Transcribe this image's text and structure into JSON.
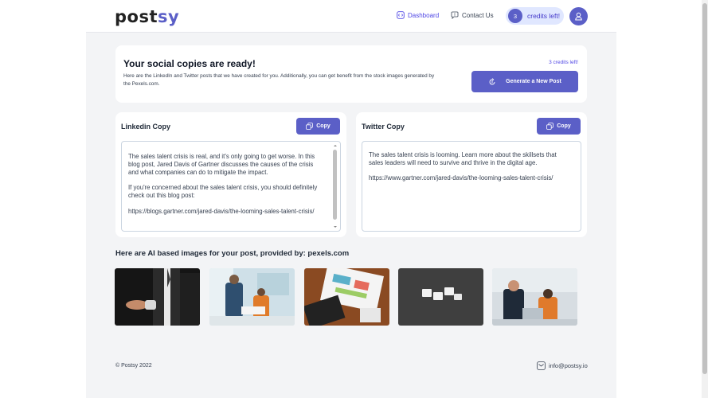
{
  "brand": {
    "logo_main": "post",
    "logo_accent": "sy",
    "accent_color": "#5b5fc7"
  },
  "nav": {
    "dashboard_label": "Dashboard",
    "dashboard_icon": "dashboard-icon",
    "contact_label": "Contact Us",
    "contact_icon": "chat-icon",
    "credits_count": "3",
    "credits_label": "credits left!",
    "avatar_icon": "user-icon"
  },
  "hero": {
    "title": "Your social copies are ready!",
    "description": "Here are the LinkedIn and Twitter posts that we have created for you. Additionally, you can get benefit from the stock images generated by the Pexels.com.",
    "credits_text": "3 credits left!",
    "generate_label": "Generate a New Post",
    "generate_icon": "refresh-icon"
  },
  "linkedin": {
    "title": "Linkedin Copy",
    "copy_label": "Copy",
    "copy_icon": "copy-icon",
    "text": "The sales talent crisis is real, and it's only going to get worse. In this blog post, Jared Davis of Gartner discusses the causes of the crisis and what companies can do to mitigate the impact.\n\nIf you're concerned about the sales talent crisis, you should definitely check out this blog post:\n\nhttps://blogs.gartner.com/jared-davis/the-looming-sales-talent-crisis/"
  },
  "twitter": {
    "title": "Twitter Copy",
    "copy_label": "Copy",
    "copy_icon": "copy-icon",
    "text": "The sales talent crisis is looming. Learn more about the skillsets that sales leaders will need to survive and thrive in the digital age.\n\nhttps://www.gartner.com/jared-davis/the-looming-sales-talent-crisis/"
  },
  "images": {
    "title": "Here are AI based images for your post, provided by: pexels.com",
    "items": [
      "handshake-photo",
      "office-meeting-photo",
      "desk-charts-photo",
      "tiles-photo",
      "coworkers-laptop-photo"
    ]
  },
  "footer": {
    "copyright": "© Postsy 2022",
    "email": "info@postsy.io",
    "email_icon": "mail-icon"
  }
}
